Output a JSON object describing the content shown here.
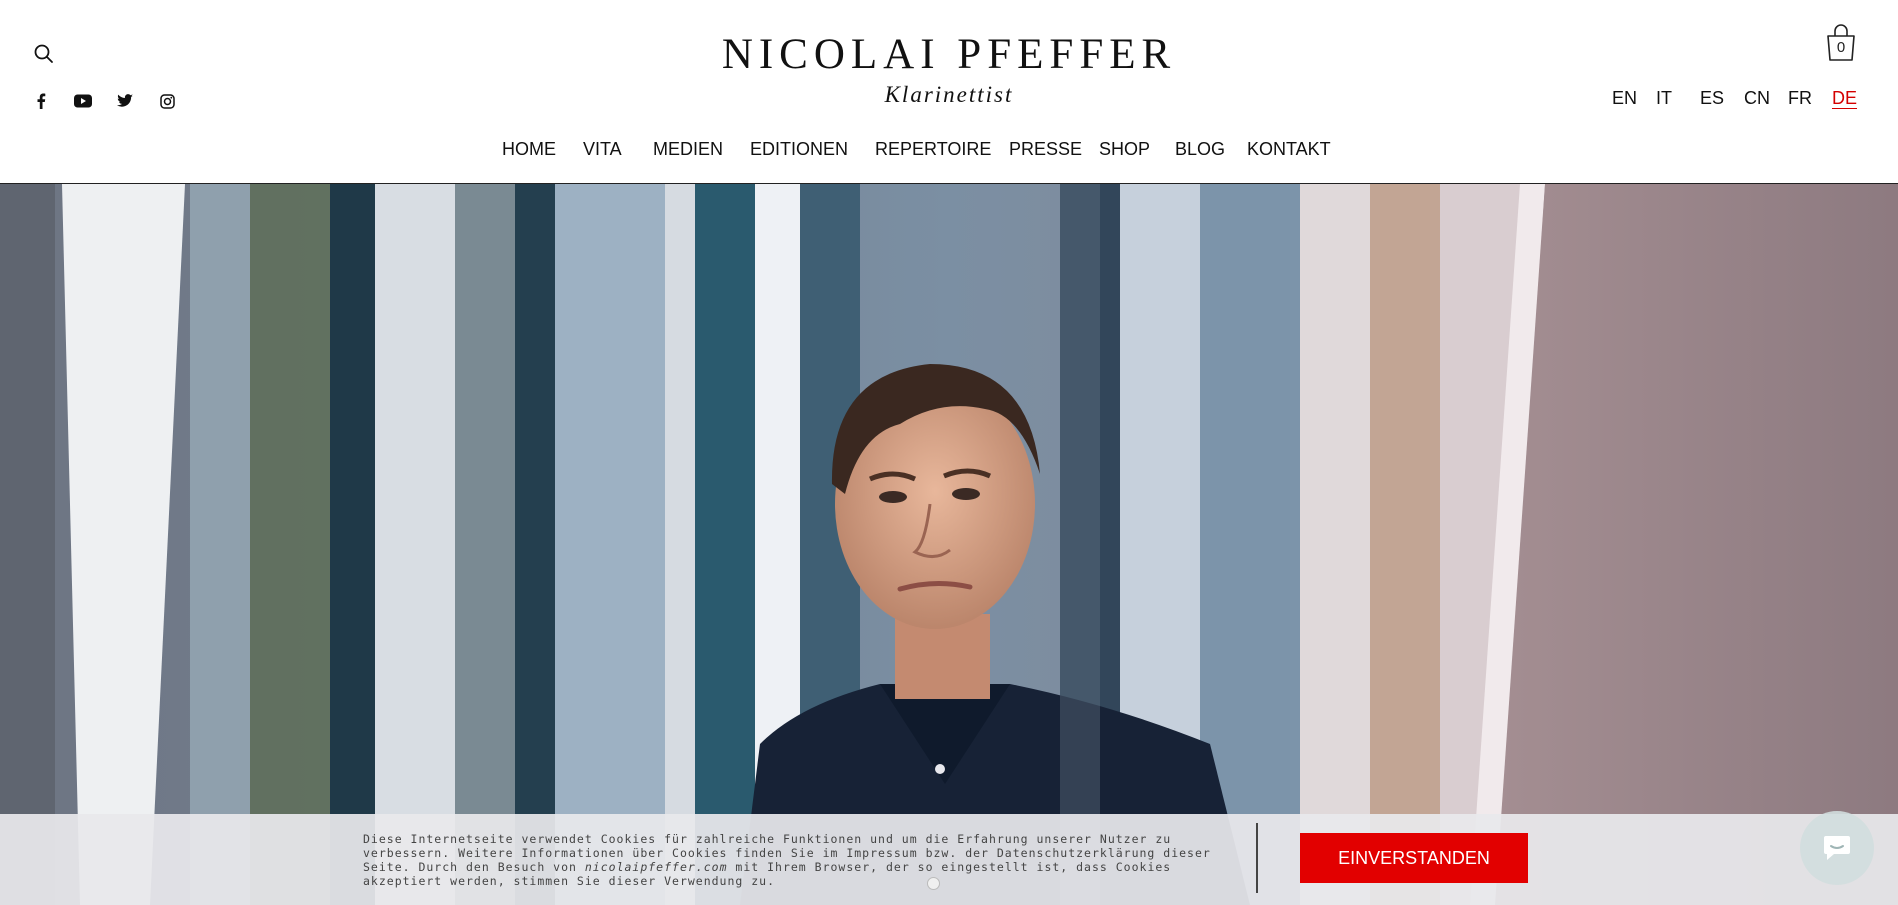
{
  "header": {
    "logo_title": "NICOLAI PFEFFER",
    "logo_subtitle": "Klarinettist",
    "cart_count": "0",
    "socials": [
      "facebook-icon",
      "youtube-icon",
      "twitter-icon",
      "instagram-icon"
    ],
    "languages": [
      "EN",
      "IT",
      "ES",
      "CN",
      "FR",
      "DE"
    ],
    "active_language": "DE"
  },
  "nav": {
    "items": [
      "HOME",
      "VITA",
      "MEDIEN",
      "EDITIONEN",
      "REPERTOIRE",
      "PRESSE",
      "SHOP",
      "BLOG",
      "KONTAKT"
    ]
  },
  "cookie": {
    "text_1": "Diese Internetseite verwendet Cookies für zahlreiche Funktionen und um die Erfahrung unserer Nutzer zu verbessern. Weitere Informationen über Cookies finden Sie im Impressum bzw. der Datenschutzerklärung dieser Seite. Durch den Besuch von ",
    "domain": "nicolaipfeffer.com",
    "text_2": " mit Ihrem Browser, der so eingestellt ist, dass Cookies akzeptiert werden, stimmen Sie dieser Verwendung zu.",
    "accept_label": "EINVERSTANDEN"
  },
  "colors": {
    "accent": "#e20000",
    "active_lang": "#d40000"
  }
}
